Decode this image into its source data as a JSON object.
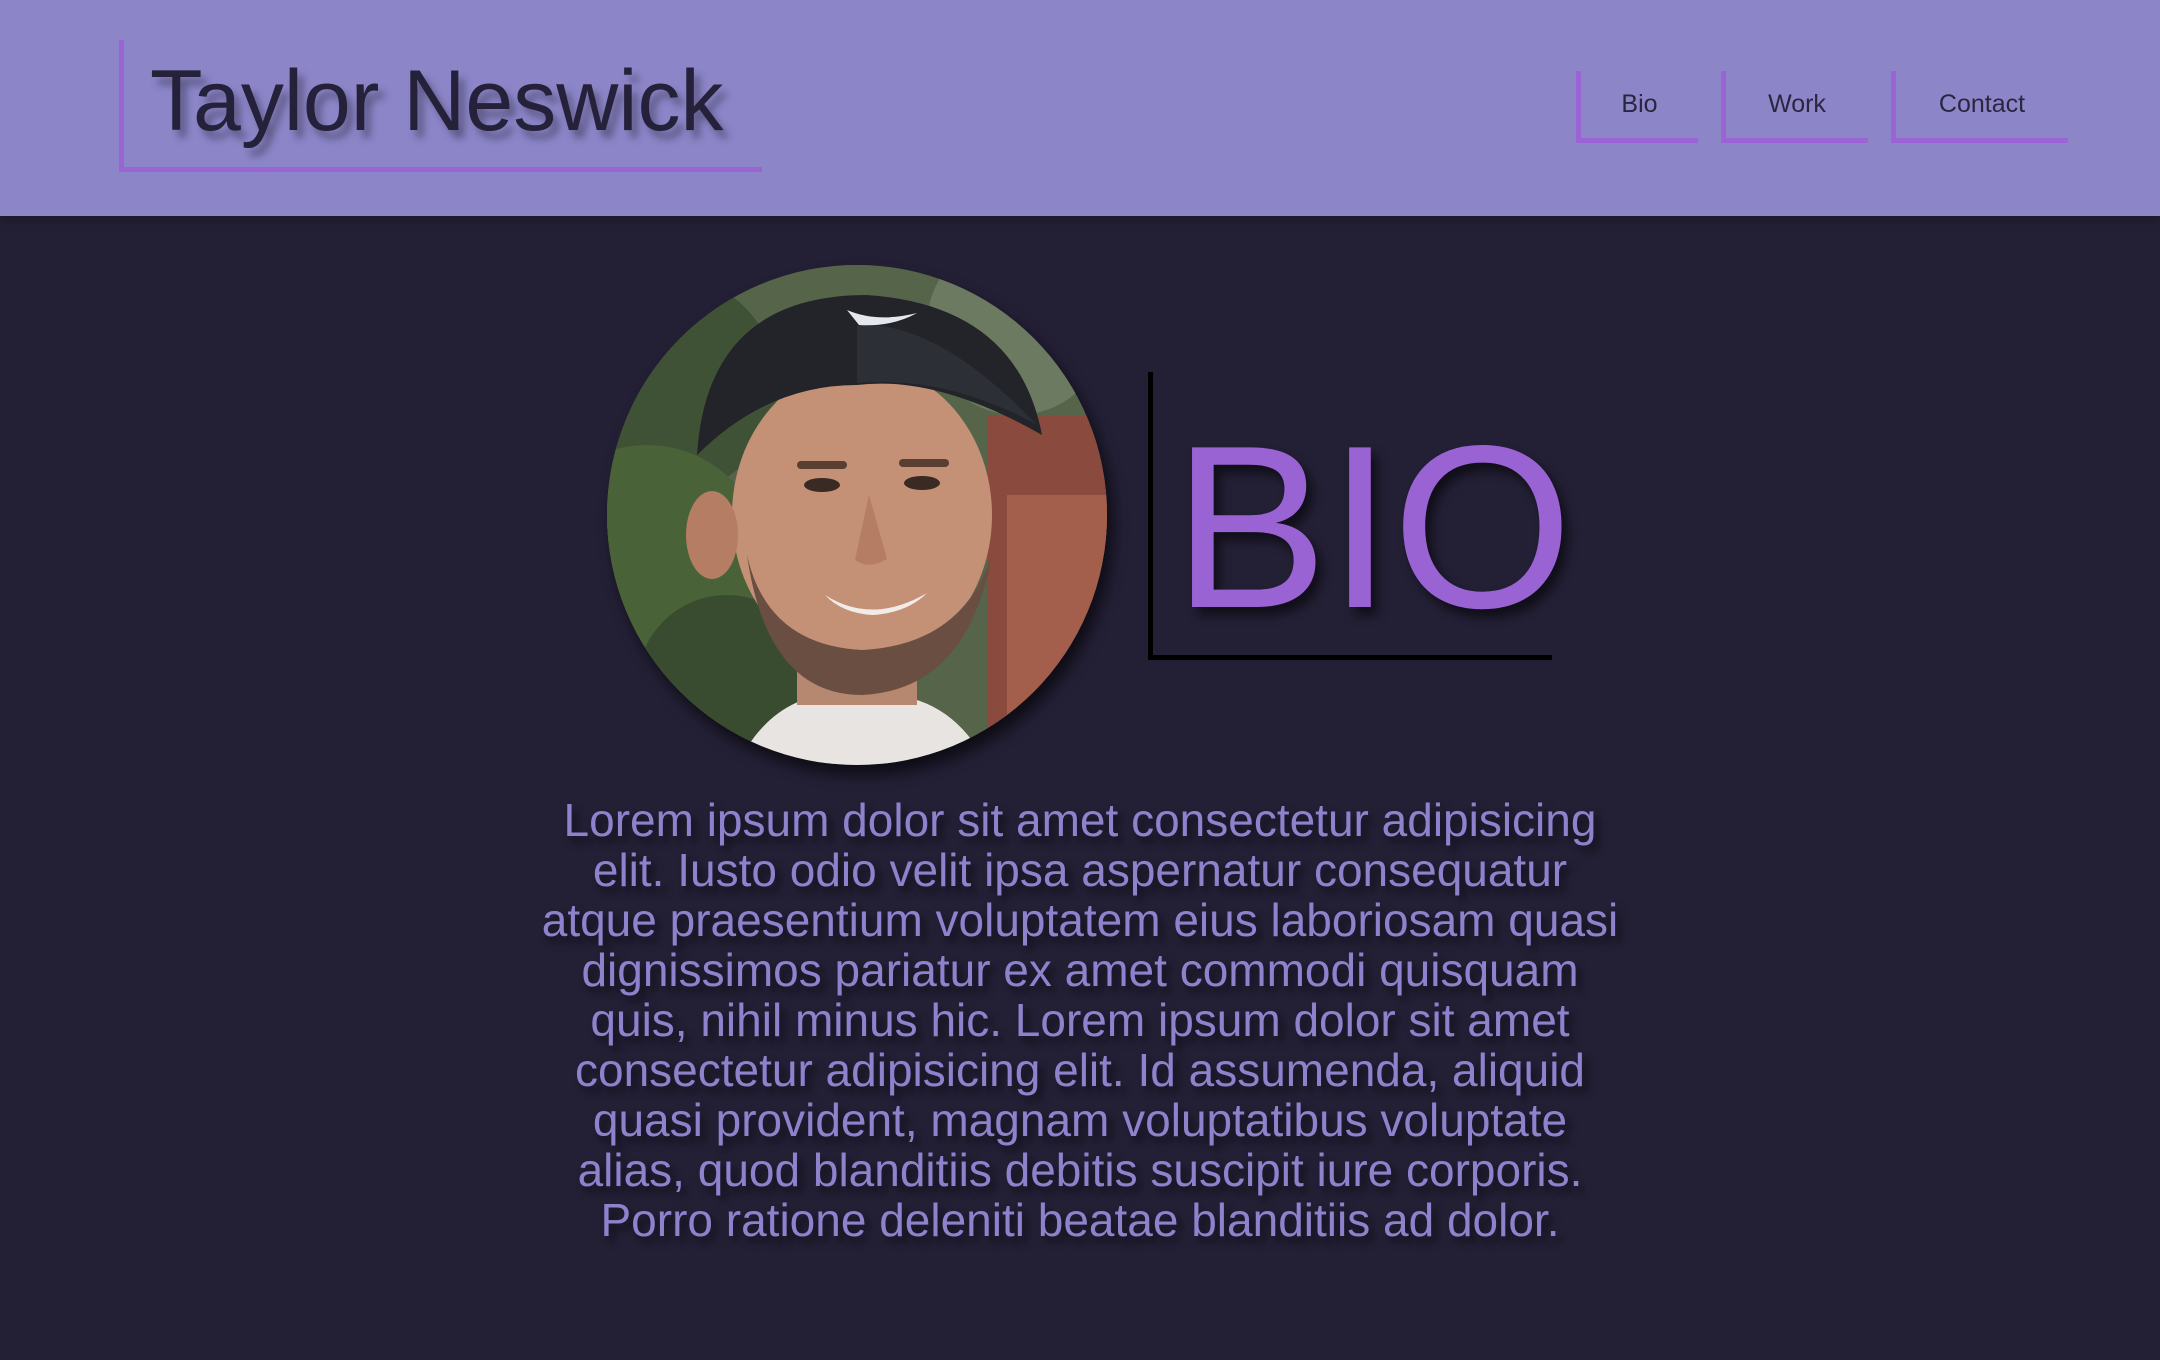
{
  "header": {
    "name": "Taylor Neswick",
    "nav": [
      {
        "label": "Bio"
      },
      {
        "label": "Work"
      },
      {
        "label": "Contact"
      }
    ]
  },
  "main": {
    "photo_alt": "Portrait photo of Taylor Neswick",
    "heading": "BIO",
    "paragraph": "Lorem ipsum dolor sit amet consectetur adipisicing elit. Iusto odio velit ipsa aspernatur consequatur atque praesentium voluptatem eius laboriosam quasi dignissimos pariatur ex amet commodi quisquam quis, nihil minus hic. Lorem ipsum dolor sit amet consectetur adipisicing elit. Id assumenda, aliquid quasi provident, magnam voluptatibus voluptate alias, quod blanditiis debitis suscipit iure corporis. Porro ratione deleniti beatae blanditiis ad dolor."
  },
  "colors": {
    "header_bg": "#8c86c9",
    "page_bg": "#231f35",
    "accent": "#9b63d4",
    "body_text": "#8d83cd"
  }
}
